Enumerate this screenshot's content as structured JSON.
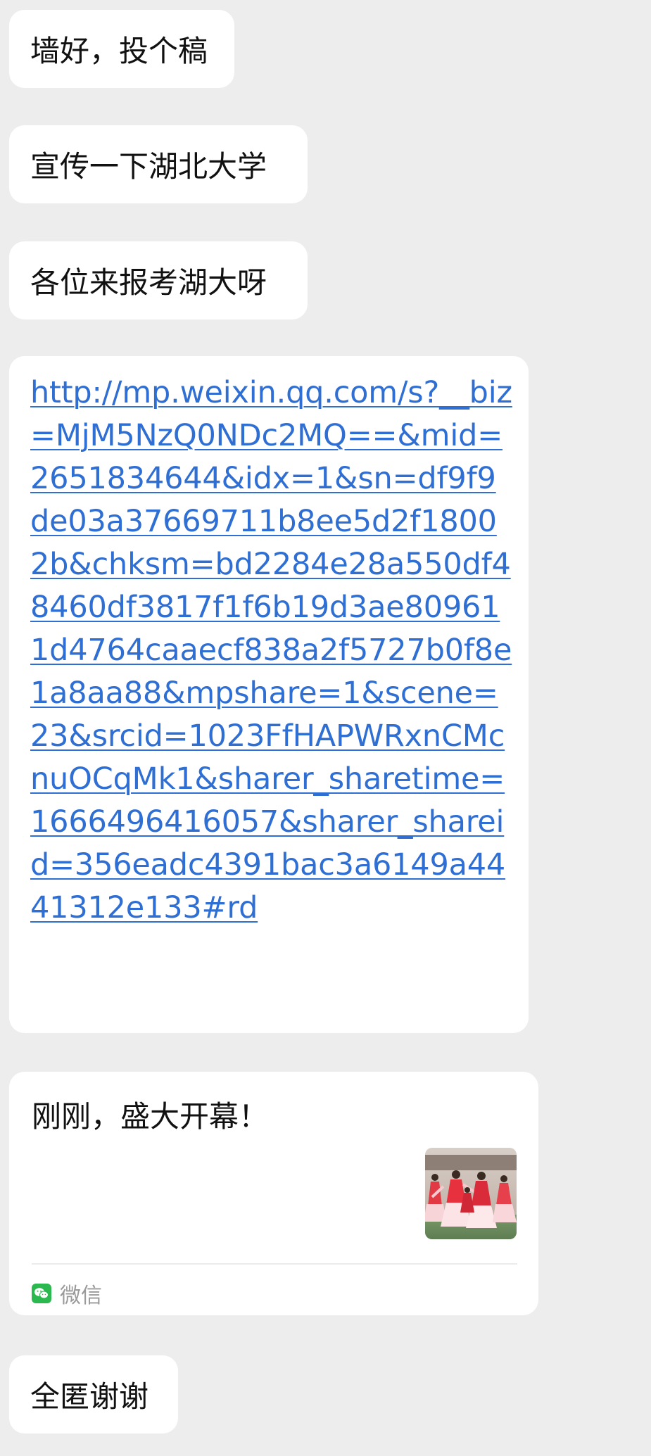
{
  "messages": [
    {
      "type": "text",
      "text": "墙好，投个稿"
    },
    {
      "type": "text",
      "text": "宣传一下湖北大学"
    },
    {
      "type": "text",
      "text": "各位来报考湖大呀"
    },
    {
      "type": "link",
      "text": "http://mp.weixin.qq.com/s?__biz=MjM5NzQ0NDc2MQ==&mid=2651834644&idx=1&sn=df9f9de03a37669711b8ee5d2f18002b&chksm=bd2284e28a550df48460df3817f1f6b19d3ae809611d4764caaecf838a2f5727b0f8e1a8aa88&mpshare=1&scene=23&srcid=1023FfHAPWRxnCMcnuOCqMk1&sharer_sharetime=1666496416057&sharer_shareid=356eadc4391bac3a6149a4441312e133#rd"
    },
    {
      "type": "card",
      "title": "刚刚，盛大开幕！",
      "thumbnail": "dancers-photo",
      "source_icon": "wechat-icon",
      "source": "微信"
    },
    {
      "type": "text",
      "text": "全匿谢谢"
    }
  ],
  "colors": {
    "background": "#ededed",
    "bubble": "#ffffff",
    "link": "#2f6fd3",
    "wechat_green": "#2bb84f",
    "source_text": "#9a9a9a"
  }
}
